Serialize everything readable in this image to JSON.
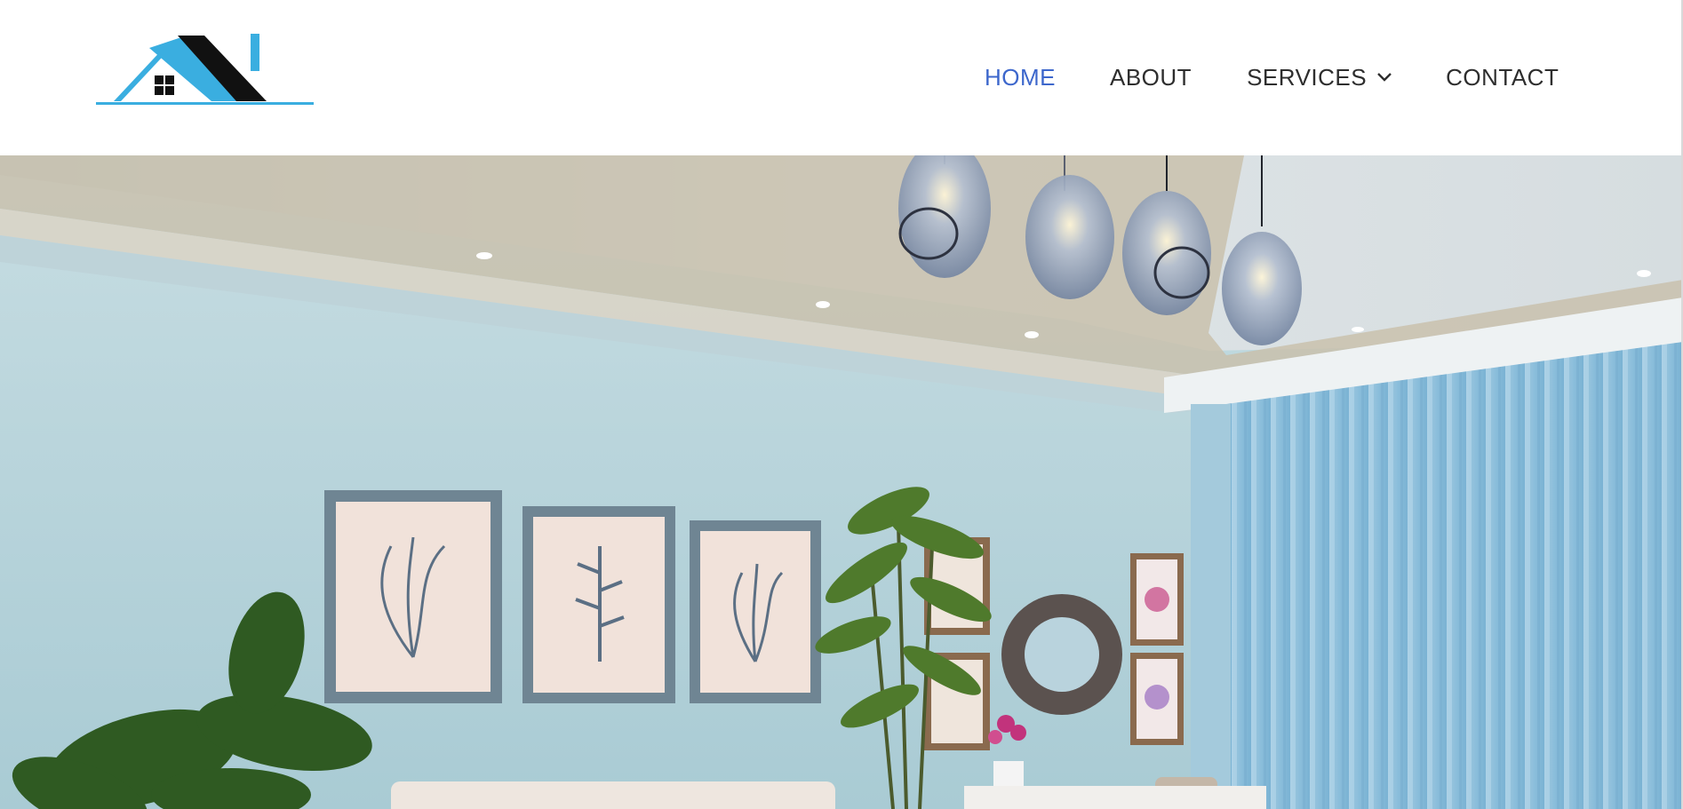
{
  "header": {
    "logo_icon": "house-roof-logo",
    "nav": {
      "home": "HOME",
      "about": "ABOUT",
      "services": "SERVICES",
      "contact": "CONTACT"
    },
    "active_item": "HOME",
    "colors": {
      "active_link": "#3d67cc",
      "link": "#2e2e2e",
      "logo_blue": "#3aaee0",
      "logo_black": "#111111"
    }
  },
  "hero": {
    "image": "living-room-interior-photo",
    "elements": [
      "pendant-lights",
      "framed-botanical-prints",
      "round-mirror",
      "bamboo-plant",
      "monstera-plant",
      "sheer-curtains"
    ]
  }
}
